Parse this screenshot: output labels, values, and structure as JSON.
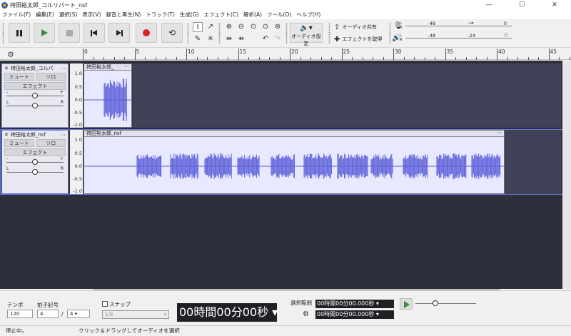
{
  "window": {
    "title": "袴田裕太郎_コルリパート_nsf",
    "controls": [
      "—",
      "☐",
      "✕"
    ]
  },
  "menu": [
    "ファイル(F)",
    "編集(E)",
    "選択(S)",
    "表示(V)",
    "録音と再生(N)",
    "トラック(T)",
    "生成(G)",
    "エフェクト(C)",
    "解析(A)",
    "ツール(O)",
    "ヘルプ(H)"
  ],
  "toolbar": {
    "audio_setup_label": "オーディオ設定",
    "share_audio_label": "オーディオ共有",
    "get_effects_label": "エフェクトを取得",
    "record_meter_marks": [
      "-48",
      "0"
    ],
    "playback_meter_marks": [
      "-48",
      "-24"
    ],
    "meter_channels": [
      "L",
      "R"
    ]
  },
  "ruler": {
    "ticks": [
      "0",
      "5",
      "10",
      "15",
      "20",
      "25",
      "30",
      "35",
      "40",
      "45"
    ]
  },
  "tracks": [
    {
      "name": "袴田裕太郎_コルパ",
      "mute_label": "ミュート",
      "solo_label": "ソロ",
      "effects_label": "エフェクト",
      "clip_title": "袴田裕太郎_",
      "scale": [
        "1.0",
        "0.5",
        "0.0",
        "-0.5",
        "-1.0"
      ],
      "pan_labels": [
        "L",
        "R"
      ],
      "gain_labels": [
        "-",
        "+"
      ]
    },
    {
      "name": "袴田裕太郎_nsf",
      "mute_label": "ミュート",
      "solo_label": "ソロ",
      "effects_label": "エフェクト",
      "clip_title": "袴田裕太郎_nsf",
      "scale": [
        "1.0",
        "0.5",
        "0.0",
        "-0.5",
        "-1.0"
      ],
      "pan_labels": [
        "L",
        "R"
      ],
      "gain_labels": [
        "-",
        "+"
      ]
    }
  ],
  "bottom": {
    "tempo_label": "テンポ",
    "tempo_value": "120",
    "time_sig_label": "拍子記号",
    "time_sig_num": "4",
    "time_sig_den": "4",
    "time_sig_sep": "/",
    "snap_label": "スナップ",
    "snap_value": "1/8",
    "time_display": "00時間00分00秒",
    "selection_label": "選択範囲",
    "sel_start": "00時間00分00.000秒",
    "sel_end": "00時間00分00.000秒"
  },
  "status": {
    "state": "停止中。",
    "hint": "クリック＆ドラッグしてオーディオを選択"
  },
  "colors": {
    "waveform": "#5b5fd9",
    "track_bg": "#2d2f3a",
    "clip_bg": "#e8e8ff",
    "record": "#d8232a",
    "play": "#3a8a3a"
  }
}
